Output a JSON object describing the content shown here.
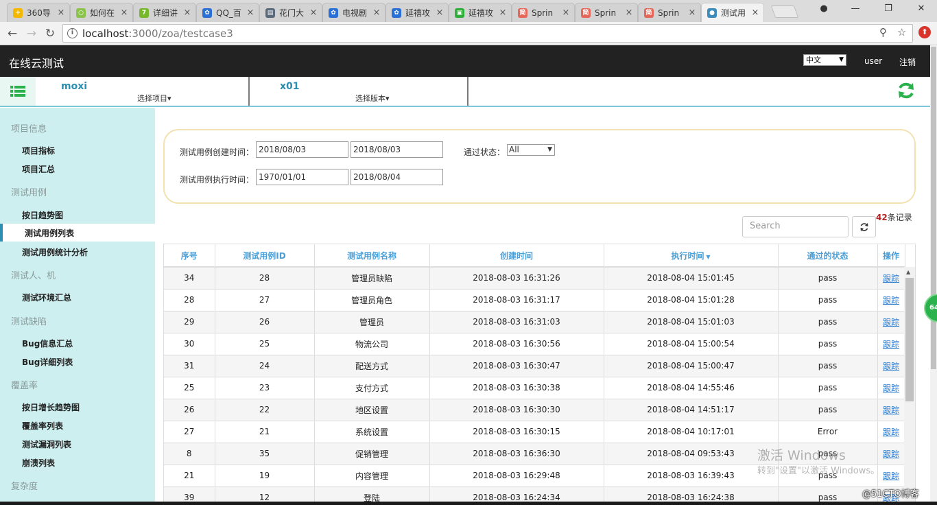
{
  "browser": {
    "tabs": [
      {
        "title": "360导",
        "icon_color": "#f5b800",
        "icon_char": "+"
      },
      {
        "title": "如何在",
        "icon_color": "#8bc34a",
        "icon_char": "○"
      },
      {
        "title": "详细讲",
        "icon_color": "#76b82a",
        "icon_char": "7"
      },
      {
        "title": "QQ_百",
        "icon_color": "#2a6fd6",
        "icon_char": "✿"
      },
      {
        "title": "花门大",
        "icon_color": "#5a6a7a",
        "icon_char": "▤"
      },
      {
        "title": "电视剧",
        "icon_color": "#2a6fd6",
        "icon_char": "✿"
      },
      {
        "title": "延禧攻",
        "icon_color": "#2a6fd6",
        "icon_char": "✿"
      },
      {
        "title": "延禧攻",
        "icon_color": "#2fae3a",
        "icon_char": "▣"
      },
      {
        "title": "Sprin",
        "icon_color": "#e5675a",
        "icon_char": "简"
      },
      {
        "title": "Sprin",
        "icon_color": "#e5675a",
        "icon_char": "简"
      },
      {
        "title": "Sprin",
        "icon_color": "#e5675a",
        "icon_char": "简"
      },
      {
        "title": "测试用",
        "icon_color": "#3c8dbc",
        "icon_char": "●"
      }
    ],
    "url_host": "localhost",
    "url_path": ":3000/zoa/testcase3"
  },
  "header": {
    "title": "在线云测试",
    "language": "中文",
    "user": "user",
    "logout": "注销"
  },
  "project_bar": {
    "project_name": "moxi",
    "project_select": "选择项目▾",
    "version_name": "x01",
    "version_select": "选择版本▾"
  },
  "sidebar": {
    "groups": [
      {
        "label": "项目信息",
        "items": [
          "项目指标",
          "项目汇总"
        ]
      },
      {
        "label": "测试用例",
        "items": [
          "按日趋势图",
          "测试用例列表",
          "测试用例统计分析"
        ]
      },
      {
        "label": "测试人、机",
        "items": [
          "测试环境汇总"
        ]
      },
      {
        "label": "测试缺陷",
        "items": [
          "Bug信息汇总",
          "Bug详细列表"
        ]
      },
      {
        "label": "覆盖率",
        "items": [
          "按日增长趋势图",
          "覆盖率列表",
          "测试漏洞列表",
          "崩溃列表"
        ]
      },
      {
        "label": "复杂度",
        "items": []
      }
    ],
    "active_item": "测试用例列表"
  },
  "filters": {
    "created_label": "测试用例创建时间：",
    "created_from": "2018/08/03",
    "created_to": "2018/08/03",
    "status_label": "通过状态：",
    "status_value": "All",
    "executed_label": "测试用例执行时间：",
    "executed_from": "1970/01/01",
    "executed_to": "2018/08/04"
  },
  "table_tools": {
    "record_count": "42",
    "record_suffix": "条记录",
    "search_placeholder": "Search"
  },
  "table": {
    "headers": [
      "序号",
      "测试用例ID",
      "测试用例名称",
      "创建时间",
      "执行时间",
      "通过的状态",
      "操作"
    ],
    "rows": [
      [
        "34",
        "28",
        "管理员缺陷",
        "2018-08-03 16:31:26",
        "2018-08-04 15:01:45",
        "pass",
        "跟踪"
      ],
      [
        "28",
        "27",
        "管理员角色",
        "2018-08-03 16:31:17",
        "2018-08-04 15:01:28",
        "pass",
        "跟踪"
      ],
      [
        "29",
        "26",
        "管理员",
        "2018-08-03 16:31:03",
        "2018-08-04 15:01:03",
        "pass",
        "跟踪"
      ],
      [
        "30",
        "25",
        "物流公司",
        "2018-08-03 16:30:56",
        "2018-08-04 15:00:54",
        "pass",
        "跟踪"
      ],
      [
        "31",
        "24",
        "配送方式",
        "2018-08-03 16:30:47",
        "2018-08-04 15:00:47",
        "pass",
        "跟踪"
      ],
      [
        "25",
        "23",
        "支付方式",
        "2018-08-03 16:30:38",
        "2018-08-04 14:55:46",
        "pass",
        "跟踪"
      ],
      [
        "26",
        "22",
        "地区设置",
        "2018-08-03 16:30:30",
        "2018-08-04 14:51:17",
        "pass",
        "跟踪"
      ],
      [
        "27",
        "21",
        "系统设置",
        "2018-08-03 16:30:15",
        "2018-08-04 10:17:01",
        "Error",
        "跟踪"
      ],
      [
        "8",
        "35",
        "促销管理",
        "2018-08-03 16:36:30",
        "2018-08-04 09:53:43",
        "pass",
        "跟踪"
      ],
      [
        "21",
        "19",
        "内容管理",
        "2018-08-03 16:29:48",
        "2018-08-03 16:39:43",
        "pass",
        "跟踪"
      ],
      [
        "39",
        "12",
        "登陆",
        "2018-08-03 16:24:34",
        "2018-08-03 16:24:38",
        "pass",
        "跟踪"
      ]
    ]
  },
  "overlay": {
    "badge": "64",
    "activate_title": "激活 Windows",
    "activate_sub": "转到\"设置\"以激活 Windows。",
    "blog_mark": "@51CTO博客"
  }
}
